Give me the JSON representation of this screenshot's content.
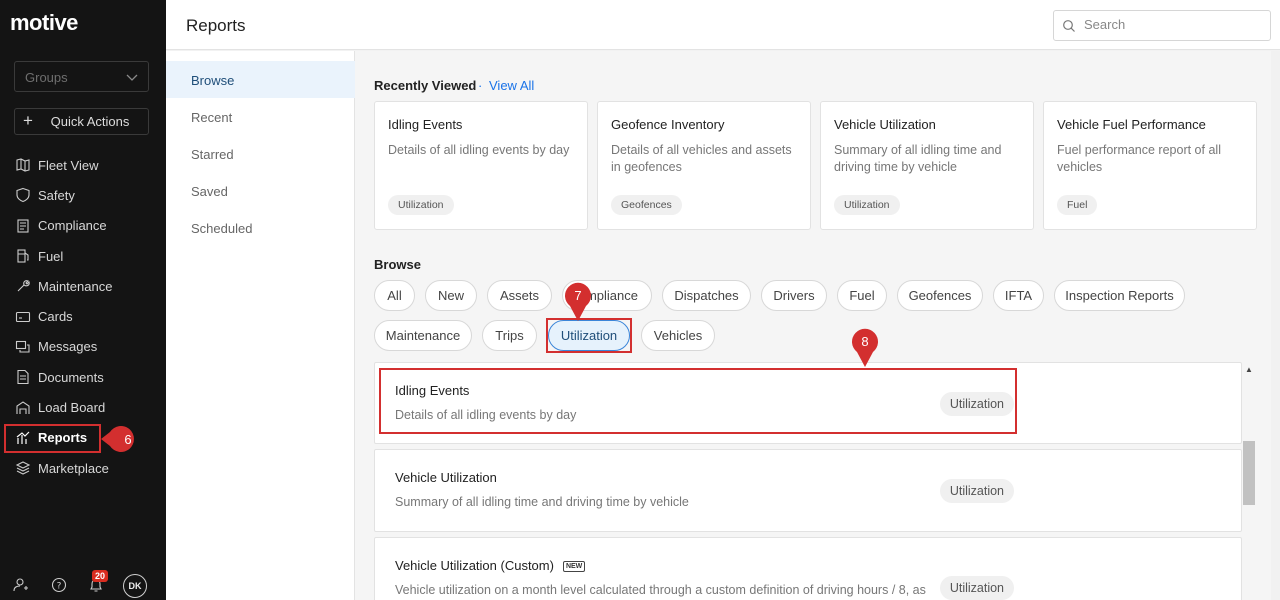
{
  "app": {
    "logo": "motive"
  },
  "sidebar": {
    "groups_placeholder": "Groups",
    "quick_actions": "Quick Actions",
    "items": [
      {
        "label": "Fleet View",
        "icon": "map-icon"
      },
      {
        "label": "Safety",
        "icon": "shield-icon"
      },
      {
        "label": "Compliance",
        "icon": "document-icon"
      },
      {
        "label": "Fuel",
        "icon": "fuel-icon"
      },
      {
        "label": "Maintenance",
        "icon": "wrench-icon"
      },
      {
        "label": "Cards",
        "icon": "card-icon"
      },
      {
        "label": "Messages",
        "icon": "messages-icon"
      },
      {
        "label": "Documents",
        "icon": "documents-icon"
      },
      {
        "label": "Load Board",
        "icon": "load-board-icon"
      },
      {
        "label": "Reports",
        "icon": "reports-icon",
        "active": true
      },
      {
        "label": "Marketplace",
        "icon": "marketplace-icon"
      }
    ],
    "notifications_count": "20",
    "avatar_initials": "DK"
  },
  "header": {
    "title": "Reports",
    "search_placeholder": "Search"
  },
  "subnav": {
    "items": [
      "Browse",
      "Recent",
      "Starred",
      "Saved",
      "Scheduled"
    ],
    "active": "Browse"
  },
  "recently_viewed": {
    "title": "Recently Viewed",
    "separator": "·",
    "view_all": "View All",
    "cards": [
      {
        "title": "Idling Events",
        "desc": "Details of all idling events by day",
        "tag": "Utilization"
      },
      {
        "title": "Geofence Inventory",
        "desc": "Details of all vehicles and assets in geofences",
        "tag": "Geofences"
      },
      {
        "title": "Vehicle Utilization",
        "desc": "Summary of all idling time and driving time by vehicle",
        "tag": "Utilization"
      },
      {
        "title": "Vehicle Fuel Performance",
        "desc": "Fuel performance report of all vehicles",
        "tag": "Fuel"
      }
    ]
  },
  "browse": {
    "title": "Browse",
    "chips": [
      "All",
      "New",
      "Assets",
      "Compliance",
      "Dispatches",
      "Drivers",
      "Fuel",
      "Geofences",
      "IFTA",
      "Inspection Reports",
      "Maintenance",
      "Trips",
      "Utilization",
      "Vehicles"
    ],
    "compliance_visible": "mpliance",
    "active_chip": "Utilization"
  },
  "reports": [
    {
      "title": "Idling Events",
      "desc": "Details of all idling events by day",
      "tag": "Utilization"
    },
    {
      "title": "Vehicle Utilization",
      "desc": "Summary of all idling time and driving time by vehicle",
      "tag": "Utilization"
    },
    {
      "title": "Vehicle Utilization (Custom)",
      "new_badge": "NEW",
      "desc": "Vehicle utilization on a month level calculated through a custom definition of driving hours / 8, as",
      "tag": "Utilization"
    }
  ],
  "annotations": {
    "step6": "6",
    "step7": "7",
    "step8": "8",
    "color": "#d32f2f"
  }
}
